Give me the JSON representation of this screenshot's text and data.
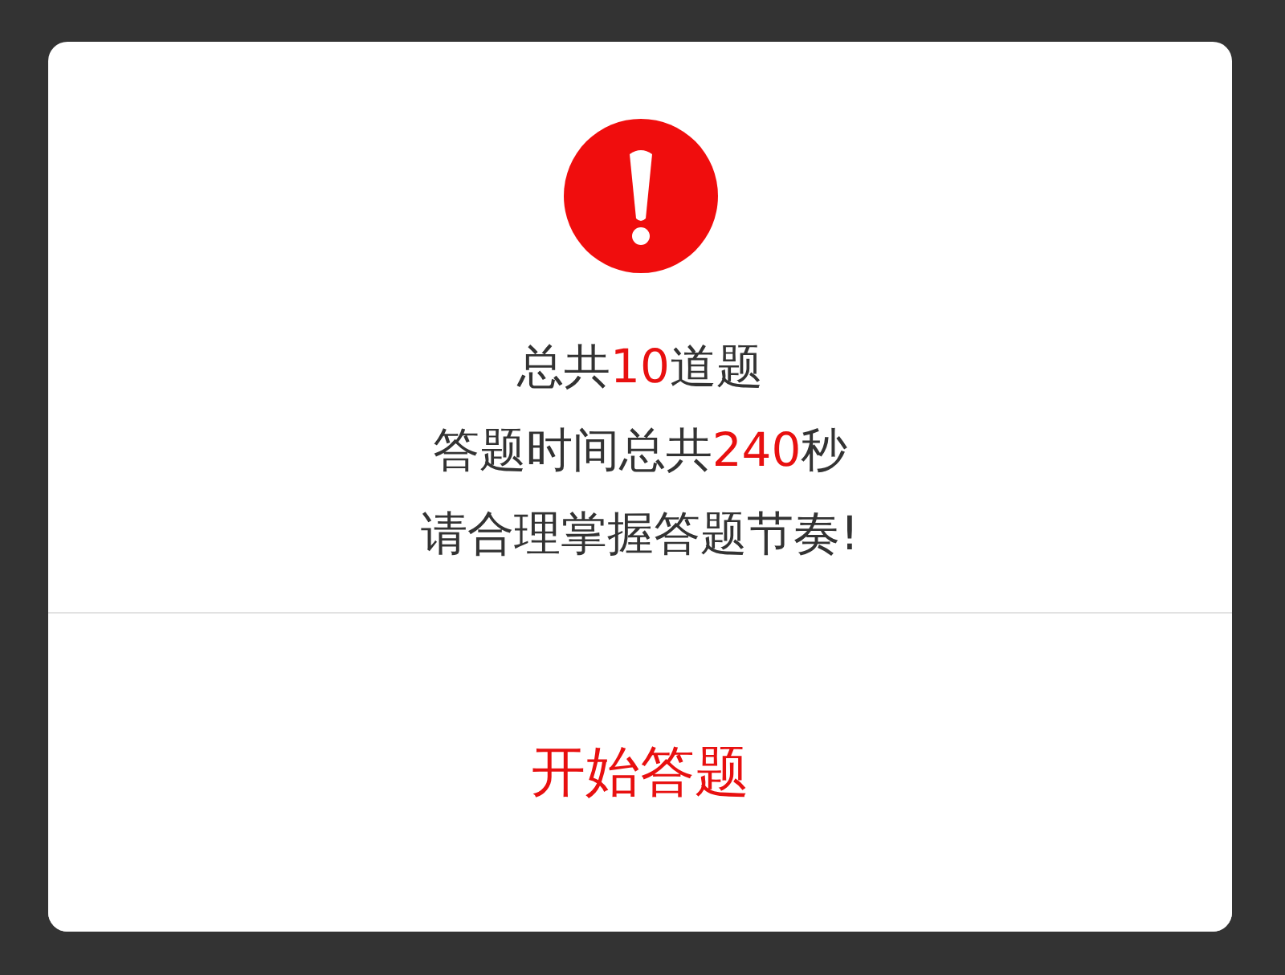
{
  "dialog": {
    "lines": [
      [
        {
          "text": "总共",
          "highlight": false
        },
        {
          "text": "10",
          "highlight": true
        },
        {
          "text": "道题",
          "highlight": false
        }
      ],
      [
        {
          "text": "答题时间总共",
          "highlight": false
        },
        {
          "text": "240",
          "highlight": true
        },
        {
          "text": "秒",
          "highlight": false
        }
      ],
      [
        {
          "text": "请合理掌握答题节奏!",
          "highlight": false
        }
      ]
    ],
    "button": "开始答题"
  }
}
